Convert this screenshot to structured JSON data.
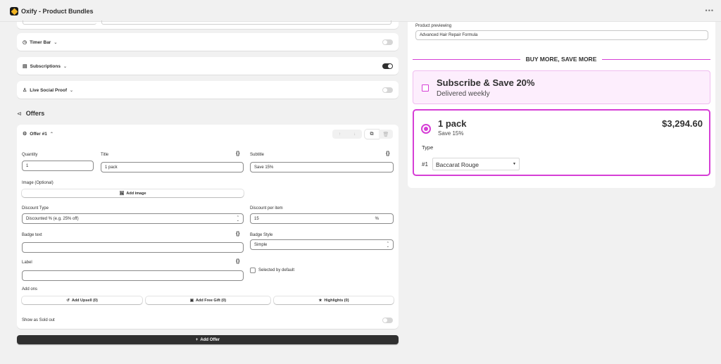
{
  "app": {
    "title": "Oxify - Product Bundles"
  },
  "sections": {
    "timer_bar": {
      "label": "Timer Bar",
      "enabled": false
    },
    "subscriptions": {
      "label": "Subscriptions",
      "enabled": true
    },
    "live_social_proof": {
      "label": "Live Social Proof",
      "enabled": false
    }
  },
  "offers": {
    "heading": "Offers",
    "offer": {
      "title": "Offer #1",
      "quantity_label": "Quantity",
      "quantity_value": "1",
      "title_label": "Title",
      "title_value": "1 pack",
      "subtitle_label": "Subtitle",
      "subtitle_value": "Save 15%",
      "image_label": "Image (Optional)",
      "add_image_label": "Add image",
      "discount_type_label": "Discount Type",
      "discount_type_value": "Discounted % (e.g. 25% off)",
      "discount_per_item_label": "Discount per item",
      "discount_per_item_value": "15",
      "discount_suffix": "%",
      "badge_text_label": "Badge text",
      "badge_text_value": "",
      "badge_style_label": "Badge Style",
      "badge_style_value": "Simple",
      "label_label": "Label",
      "label_value": "",
      "selected_default_label": "Selected by default",
      "add_ons_label": "Add ons",
      "add_upsell_label": "Add Upsell (0)",
      "add_free_gift_label": "Add Free Gift (0)",
      "highlights_label": "Highlights (0)",
      "sold_out_label": "Show as Sold out",
      "sold_out_enabled": false
    },
    "add_offer_label": "Add Offer",
    "braces": "{}"
  },
  "preview": {
    "product_previewing_label": "Product previewing",
    "product_value": "Advanced Hair Repair Formula",
    "banner": "BUY MORE, SAVE MORE",
    "subscribe": {
      "title": "Subscribe & Save 20%",
      "subtitle": "Delivered weekly"
    },
    "pack": {
      "title": "1 pack",
      "subtitle": "Save 15%",
      "price": "$3,294.60",
      "type_label": "Type",
      "variant_index": "#1",
      "variant_value": "Baccarat Rouge"
    },
    "colors": {
      "accent": "#d63ed6",
      "accent_bg": "#fdeefd"
    }
  }
}
